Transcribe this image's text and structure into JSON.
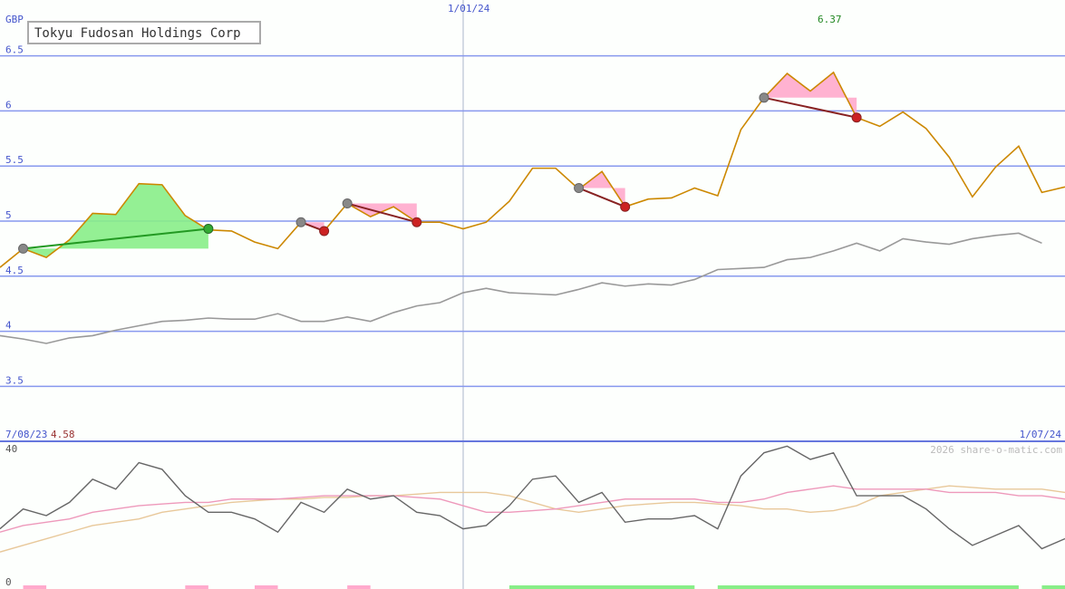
{
  "chart_data": [
    {
      "type": "line",
      "title": "Tokyu Fudosan Holdings Corp",
      "currency": "GBP",
      "ylim": [
        3.25,
        6.95
      ],
      "y_ticks": [
        "6.5",
        "6",
        "5.5",
        "5",
        "4.5",
        "4",
        "3.5"
      ],
      "x_ticks": [
        "1/01/24"
      ],
      "start_date": "7/08/23",
      "start_value": "4.58",
      "end_date": "1/07/24",
      "max_label": "6.37",
      "grid": true,
      "series": [
        {
          "color": "#cc8800",
          "values": [
            4.58,
            4.75,
            4.67,
            4.83,
            5.07,
            5.06,
            5.34,
            5.33,
            5.05,
            4.92,
            4.91,
            4.81,
            4.75,
            4.99,
            4.91,
            5.16,
            5.04,
            5.13,
            4.99,
            4.99,
            4.93,
            4.99,
            5.18,
            5.48,
            5.48,
            5.29,
            5.45,
            5.13,
            5.2,
            5.21,
            5.3,
            5.23,
            5.83,
            6.12,
            6.34,
            6.18,
            6.35,
            5.94,
            5.86,
            5.99,
            5.84,
            5.58,
            5.22,
            5.49,
            5.68,
            5.26,
            5.31
          ]
        },
        {
          "color": "#999999",
          "values": [
            3.96,
            3.93,
            3.89,
            3.94,
            3.96,
            4.01,
            4.05,
            4.09,
            4.1,
            4.12,
            4.11,
            4.11,
            4.16,
            4.09,
            4.09,
            4.13,
            4.09,
            4.17,
            4.23,
            4.26,
            4.35,
            4.39,
            4.35,
            4.34,
            4.33,
            4.38,
            4.44,
            4.41,
            4.43,
            4.42,
            4.47,
            4.56,
            4.57,
            4.58,
            4.65,
            4.67,
            4.73,
            4.8,
            4.73,
            4.84,
            4.81,
            4.79,
            4.84,
            4.87,
            4.89,
            4.8
          ]
        }
      ],
      "trades": [
        {
          "type": "gain",
          "start_index": 1,
          "start_value": 4.75,
          "end_index": 9,
          "end_value": 4.93
        },
        {
          "type": "loss",
          "start_index": 13,
          "start_value": 4.99,
          "end_index": 14,
          "end_value": 4.91
        },
        {
          "type": "loss",
          "start_index": 15,
          "start_value": 5.16,
          "end_index": 18,
          "end_value": 4.99
        },
        {
          "type": "loss",
          "start_index": 25,
          "start_value": 5.3,
          "end_index": 27,
          "end_value": 5.13
        },
        {
          "type": "loss",
          "start_index": 33,
          "start_value": 6.12,
          "end_index": 37,
          "end_value": 5.94
        }
      ]
    },
    {
      "type": "line",
      "ylim": [
        0,
        40
      ],
      "y_ticks": [
        "40",
        "0"
      ],
      "watermark": "2026 share-o-matic.com",
      "series": [
        {
          "color": "#666666",
          "values": [
            16,
            22,
            20,
            24,
            31,
            28,
            36,
            34,
            26,
            21,
            21,
            19,
            15,
            24,
            21,
            28,
            25,
            26,
            21,
            20,
            16,
            17,
            23,
            31,
            32,
            24,
            27,
            18,
            19,
            19,
            20,
            16,
            32,
            39,
            41,
            37,
            39,
            26,
            26,
            26,
            22,
            16,
            11,
            14,
            17,
            10,
            13
          ]
        },
        {
          "color": "#ee99bb",
          "values": [
            15,
            17,
            18,
            19,
            21,
            22,
            23,
            23.5,
            24,
            24,
            25,
            25,
            25,
            25.5,
            26,
            26,
            26,
            26,
            25.5,
            25,
            23,
            21,
            21,
            21.5,
            22,
            23,
            24,
            25,
            25,
            25,
            25,
            24,
            24,
            25,
            27,
            28,
            29,
            28,
            28,
            28,
            28,
            27,
            27,
            27,
            26,
            26,
            25
          ]
        },
        {
          "color": "#e8c89a",
          "values": [
            9,
            11,
            13,
            15,
            17,
            18,
            19,
            21,
            22,
            23,
            24,
            24.5,
            25,
            25,
            25.5,
            25.5,
            26,
            26,
            26.5,
            27,
            27,
            27,
            26,
            24,
            22,
            21,
            22,
            23,
            23.5,
            24,
            24,
            23.5,
            23,
            22,
            22,
            21,
            21.5,
            23,
            26,
            27,
            28,
            29,
            28.5,
            28,
            28,
            28,
            27
          ]
        }
      ],
      "volume_marks": [
        {
          "type": "loss",
          "start": 1,
          "end": 2
        },
        {
          "type": "loss",
          "start": 8,
          "end": 9
        },
        {
          "type": "loss",
          "start": 11,
          "end": 12
        },
        {
          "type": "loss",
          "start": 15,
          "end": 16
        },
        {
          "type": "gain",
          "start": 22,
          "end": 30
        },
        {
          "type": "gain",
          "start": 31,
          "end": 44
        },
        {
          "type": "gain",
          "start": 45,
          "end": 46
        }
      ]
    }
  ]
}
